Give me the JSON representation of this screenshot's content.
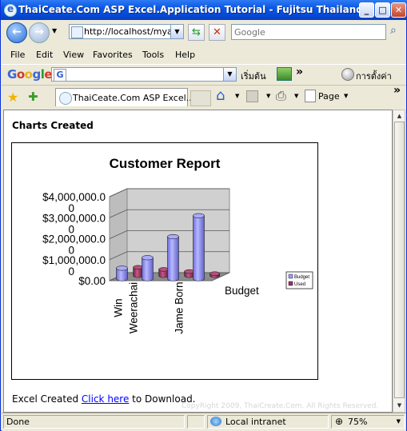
{
  "window": {
    "title": "ThaiCeate.Com ASP Excel.Application Tutorial - Fujitsu Thailand"
  },
  "navbar": {
    "address": "http://localhost/myasp",
    "search_placeholder": "Google"
  },
  "menu": [
    "File",
    "Edit",
    "View",
    "Favorites",
    "Tools",
    "Help"
  ],
  "google_bar": {
    "logo": "Google",
    "g_label": "G",
    "thai_start": "เริ่มต้น",
    "thai_settings": "การตั้งค่า",
    "more": "»"
  },
  "tabs": {
    "active_label": "ThaiCeate.Com ASP Excel...",
    "page_label": "Page",
    "more": "»"
  },
  "page": {
    "heading": "Charts Created",
    "footer_before": "Excel Created ",
    "footer_link": "Click here",
    "footer_after": " to Download.",
    "watermark": "CopyRight 2009, ThaiCreate.Com. All Rights Reserved."
  },
  "chart_data": {
    "type": "bar",
    "title": "Customer Report",
    "categories": [
      "Win",
      "Weerachai",
      "Jame Born"
    ],
    "category_depth_label": "Budget",
    "series": [
      {
        "name": "Budget",
        "values": [
          500000,
          1000000,
          2000000,
          3000000
        ],
        "color": "#9999ff"
      },
      {
        "name": "Used",
        "values": [
          400000,
          300000,
          200000,
          100000
        ],
        "color": "#993366"
      }
    ],
    "ytick_labels": [
      "$4,000,000.0\n0",
      "$3,000,000.0\n0",
      "$2,000,000.0\n0",
      "$1,000,000.0\n0",
      "$0.00"
    ],
    "ylim": [
      0,
      4000000
    ]
  },
  "status": {
    "text": "Done",
    "zone": "Local intranet",
    "zoom": "75%"
  }
}
